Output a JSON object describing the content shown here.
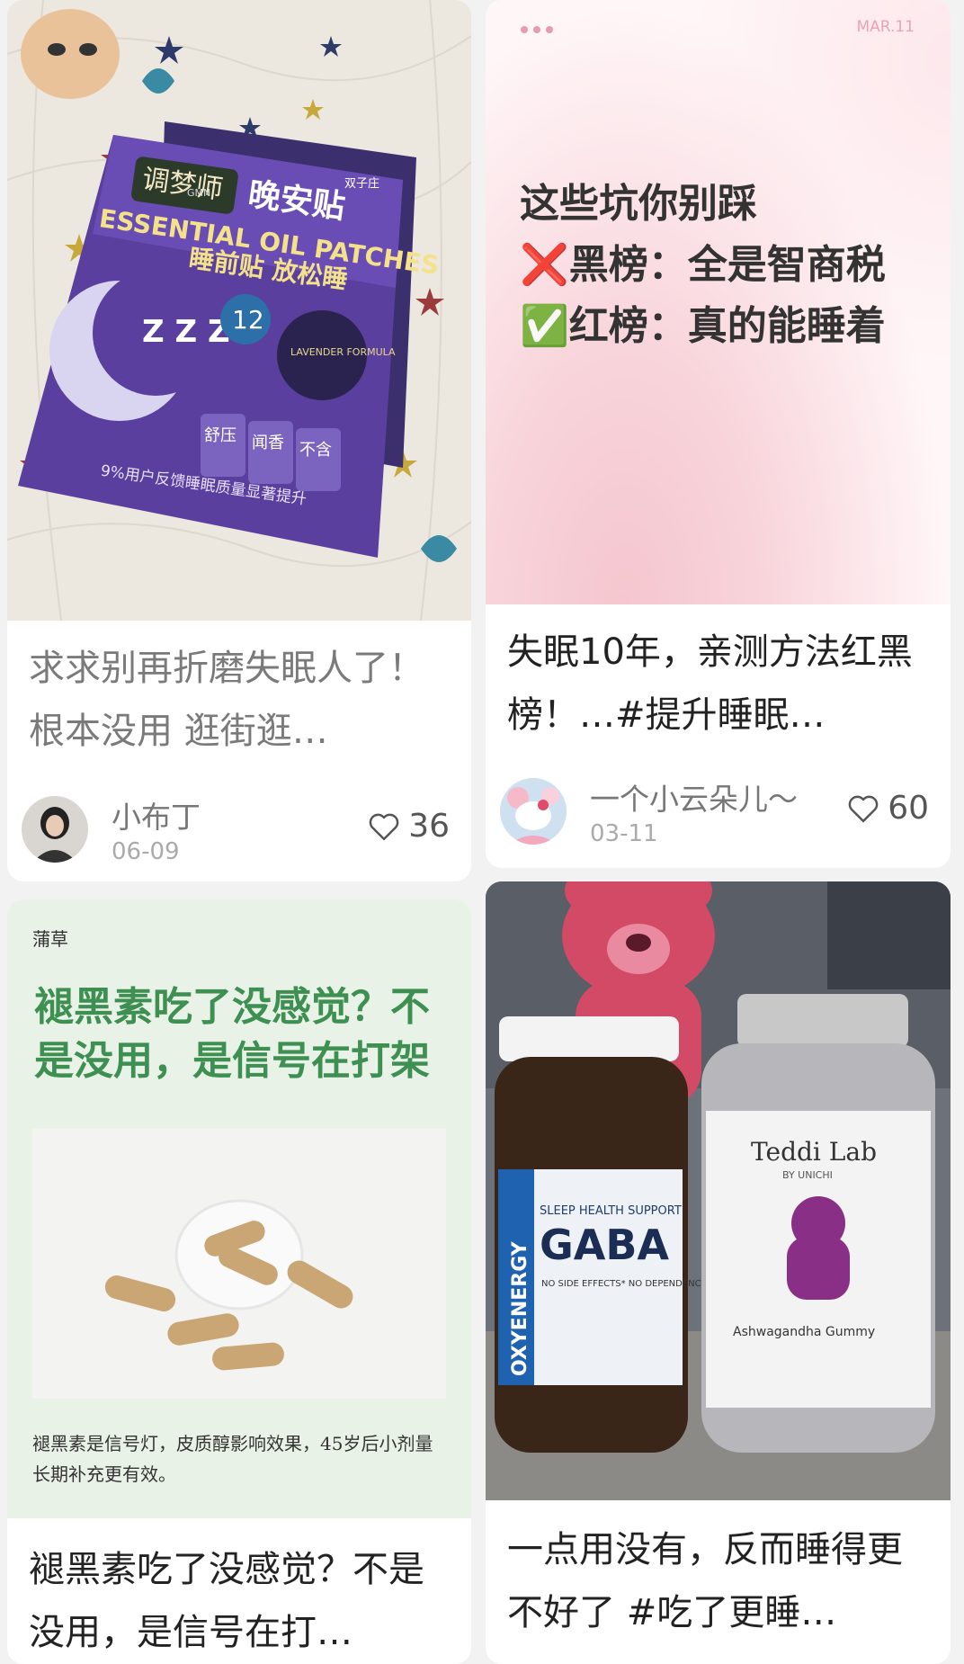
{
  "feed": [
    {
      "title": "求求别再折磨失眠人了！根本没用 逛街逛…",
      "author": "小布丁",
      "date": "06-09",
      "likes": "36",
      "product": {
        "brand": "调梦师",
        "brand_sub": "GMN",
        "name": "晚安贴",
        "maker": "双子庄",
        "english": "ESSENTIAL OIL PATCHES",
        "tagline": "睡前贴 放松睡",
        "hours": "12",
        "lavender": "LAVENDER FORMULA",
        "badge1": "舒压",
        "badge2": "闻香",
        "badge3": "不含",
        "banner": "9%用户反馈睡眠质量显著提升"
      }
    },
    {
      "date_tag": "MAR.11",
      "line1": "这些坑你别踩",
      "line2": "❌黑榜：全是智商税",
      "line3": "✅红榜：真的能睡着",
      "title": "失眠10年，亲测方法红黑榜！…#提升睡眠…",
      "author": "一个小云朵儿～",
      "date": "03-11",
      "likes": "60"
    },
    {
      "category": "蒲草",
      "headline": "褪黑素吃了没感觉？不是没用，是信号在打架",
      "caption": "褪黑素是信号灯，皮质醇影响效果，45岁后小剂量长期补充更有效。",
      "title": "褪黑素吃了没感觉？不是没用，是信号在打…"
    },
    {
      "bottle1_brand": "OXYENERGY",
      "bottle1_label": "SLEEP HEALTH SUPPORT",
      "bottle1_name": "GABA",
      "bottle1_note": "NO SIDE EFFECTS* NO DEPENDENCY*",
      "bottle2_brand": "Teddi Lab",
      "bottle2_sub": "BY UNICHI",
      "bottle2_name": "Ashwagandha Gummy",
      "title": "一点用没有，反而睡得更不好了 #吃了更睡…"
    }
  ]
}
